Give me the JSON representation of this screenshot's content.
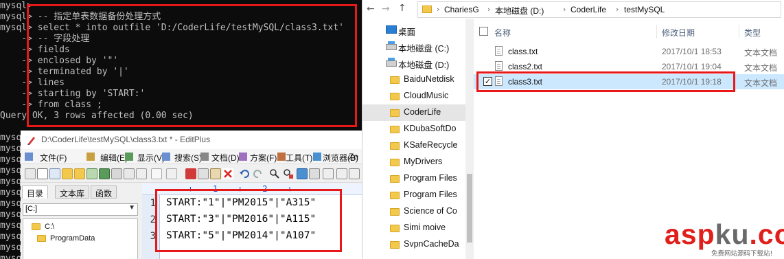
{
  "terminal": {
    "lines": [
      "mysql>",
      "mysql> -- 指定单表数据备份处理方式",
      "mysql> select * into outfile 'D:/CoderLife/testMySQL/class3.txt'",
      "    -> -- 字段处理",
      "    -> fields",
      "    -> enclosed by '\"'",
      "    -> terminated by '|'",
      "    -> lines",
      "    -> starting by 'START:'",
      "    -> from class ;",
      "Query OK, 3 rows affected (0.00 sec)",
      "",
      "mysql>",
      "mysql>",
      "mysql>",
      "mysql>",
      "mysql>",
      "mysql>",
      "mysql>",
      "mysql>",
      "mysql>",
      "mysql>",
      "mysql>",
      "mysql>"
    ]
  },
  "editplus": {
    "title": "D:\\CoderLife\\testMySQL\\class3.txt * - EditPlus",
    "menu": [
      "文件(F)",
      "编辑(E)",
      "显示(V)",
      "搜索(S)",
      "文档(D)",
      "方案(F)",
      "工具(T)",
      "浏览器(B)",
      "Ze"
    ],
    "side_tabs": [
      "目录",
      "文本库",
      "函数"
    ],
    "drive": "[C:]",
    "dirs": [
      "C:\\",
      "ProgramData"
    ],
    "ruler": "----+----1----+----2----+-",
    "line_numbers": [
      "1",
      "2",
      "3"
    ],
    "code_lines": [
      "START:\"1\"|\"PM2015\"|\"A315\"",
      "START:\"3\"|\"PM2016\"|\"A115\"",
      "START:\"5\"|\"PM2014\"|\"A107\""
    ]
  },
  "explorer": {
    "breadcrumb": [
      "ChariesG",
      "本地磁盘 (D:)",
      "CoderLife",
      "testMySQL"
    ],
    "nav_items": [
      {
        "label": "桌面",
        "icon": "desktop-icon"
      },
      {
        "label": "本地磁盘 (C:)",
        "icon": "drive-icon"
      },
      {
        "label": "本地磁盘 (D:)",
        "icon": "drive-icon"
      },
      {
        "label": "BaiduNetdisk",
        "icon": "folder-icon"
      },
      {
        "label": "CloudMusic",
        "icon": "folder-icon"
      },
      {
        "label": "CoderLife",
        "icon": "folder-icon"
      },
      {
        "label": "KDubaSoftDo",
        "icon": "folder-icon"
      },
      {
        "label": "KSafeRecycle",
        "icon": "folder-icon"
      },
      {
        "label": "MyDrivers",
        "icon": "folder-icon"
      },
      {
        "label": "Program Files",
        "icon": "folder-icon"
      },
      {
        "label": "Program Files",
        "icon": "folder-icon"
      },
      {
        "label": "Science of Co",
        "icon": "folder-icon"
      },
      {
        "label": "Simi moive",
        "icon": "folder-icon"
      },
      {
        "label": "SvpnCacheDa",
        "icon": "folder-icon"
      }
    ],
    "columns": {
      "name": "名称",
      "date": "修改日期",
      "type": "类型"
    },
    "files": [
      {
        "name": "class.txt",
        "date": "2017/10/1 18:53",
        "type": "文本文档"
      },
      {
        "name": "class2.txt",
        "date": "2017/10/1 19:04",
        "type": "文本文档"
      },
      {
        "name": "class3.txt",
        "date": "2017/10/1 19:18",
        "type": "文本文档"
      }
    ],
    "selected_check": "✓"
  },
  "watermark": {
    "red1": "asp",
    "grey": "ku",
    "red2": ".com",
    "sub": "免费网站源码下载站!"
  }
}
